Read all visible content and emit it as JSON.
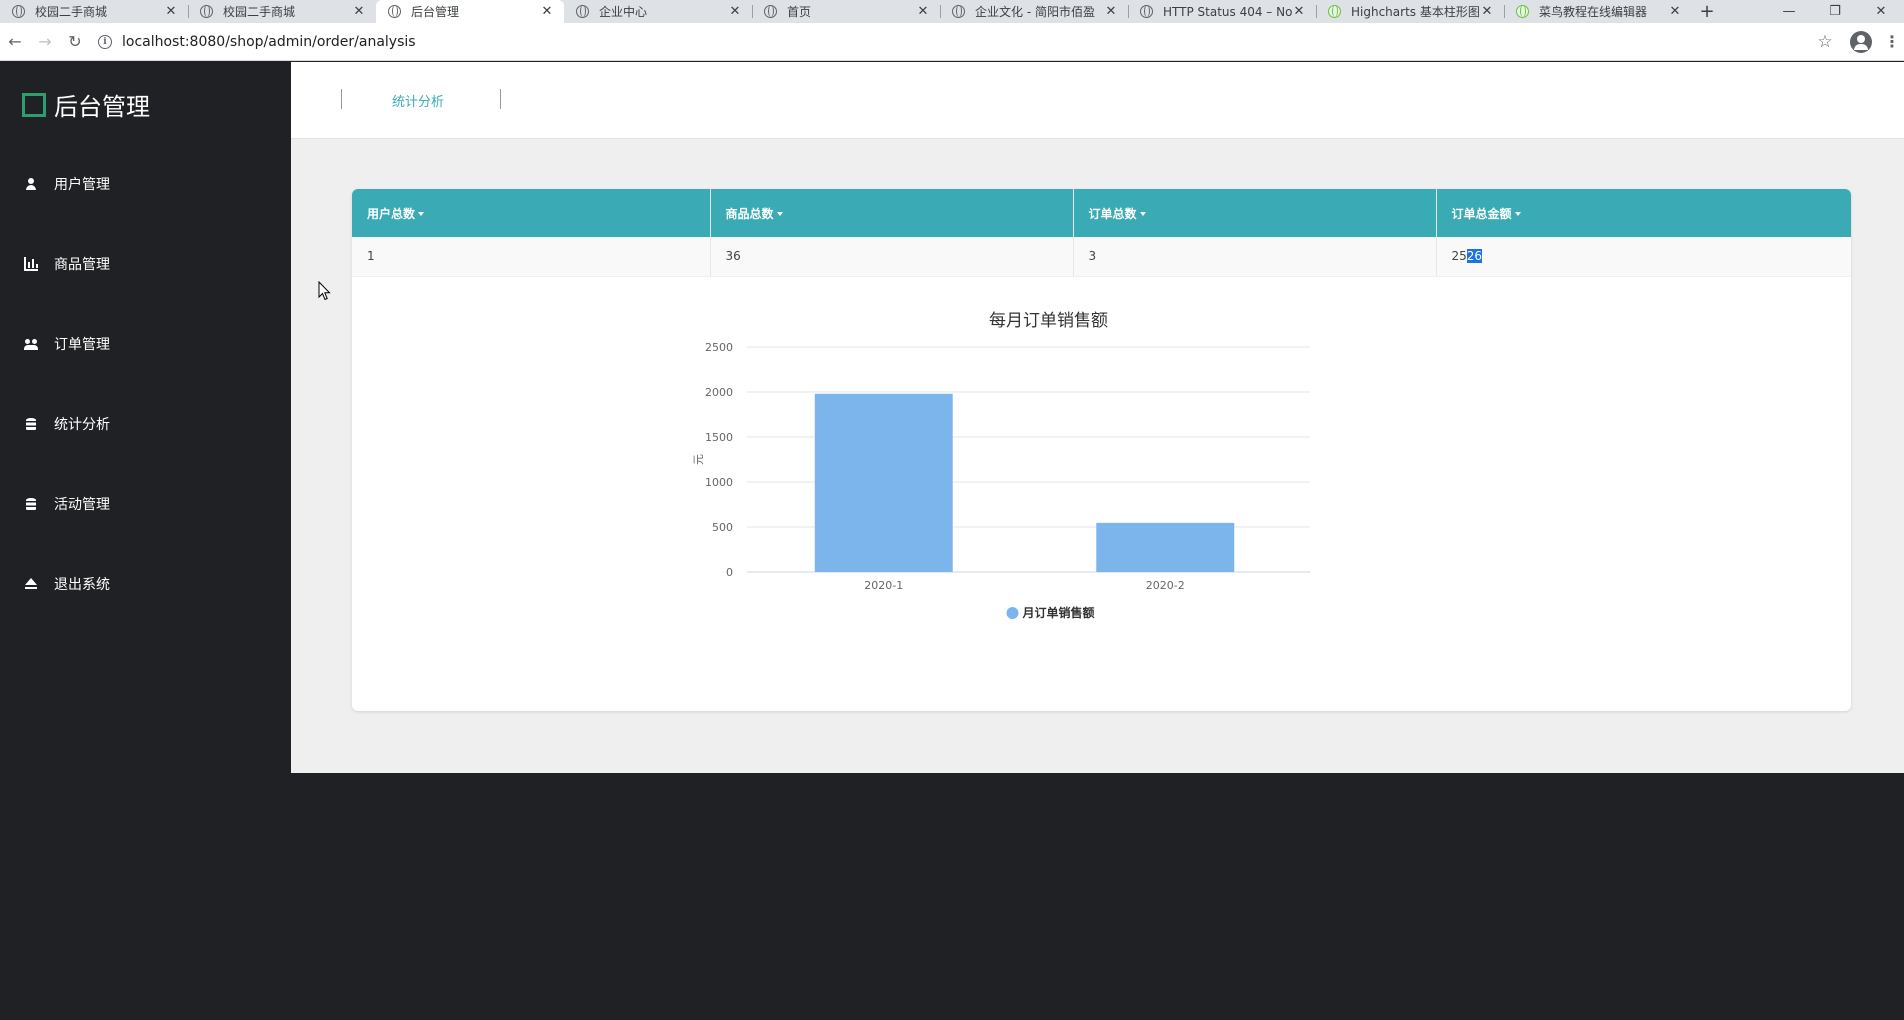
{
  "browser": {
    "tabs": [
      {
        "title": "校园二手商城",
        "favicon": "globe-icon",
        "active": false
      },
      {
        "title": "校园二手商城",
        "favicon": "globe-icon",
        "active": false
      },
      {
        "title": "后台管理",
        "favicon": "globe-icon",
        "active": true
      },
      {
        "title": "企业中心",
        "favicon": "globe-icon",
        "active": false
      },
      {
        "title": "首页",
        "favicon": "globe-icon",
        "active": false
      },
      {
        "title": "企业文化 - 简阳市佰盈",
        "favicon": "globe-icon",
        "active": false
      },
      {
        "title": "HTTP Status 404 – No",
        "favicon": "globe-icon",
        "active": false
      },
      {
        "title": "Highcharts 基本柱形图",
        "favicon": "runoob-icon",
        "active": false
      },
      {
        "title": "菜鸟教程在线编辑器",
        "favicon": "runoob-icon",
        "active": false
      }
    ],
    "new_tab": "+",
    "url": "localhost:8080/shop/admin/order/analysis"
  },
  "sidebar": {
    "brand": "后台管理",
    "items": [
      {
        "label": "用户管理",
        "icon": "user-icon"
      },
      {
        "label": "商品管理",
        "icon": "bar-chart-icon"
      },
      {
        "label": "订单管理",
        "icon": "users-icon"
      },
      {
        "label": "统计分析",
        "icon": "database-icon"
      },
      {
        "label": "活动管理",
        "icon": "database-icon"
      },
      {
        "label": "退出系统",
        "icon": "eject-icon"
      }
    ]
  },
  "header": {
    "breadcrumb": "统计分析"
  },
  "stats": {
    "headers": [
      "用户总数",
      "商品总数",
      "订单总数",
      "订单总金额"
    ],
    "values": [
      "1",
      "36",
      "3",
      "2526"
    ]
  },
  "chart_data": {
    "type": "bar",
    "title": "每月订单销售额",
    "xlabel": "",
    "ylabel": "元",
    "categories": [
      "2020-1",
      "2020-2"
    ],
    "series": [
      {
        "name": "月订单销售额",
        "values": [
          1980,
          546
        ]
      }
    ],
    "ylim": [
      0,
      2500
    ],
    "yticks": [
      0,
      500,
      1000,
      1500,
      2000,
      2500
    ],
    "grid": true,
    "legend": "bottom-center"
  },
  "colors": {
    "accent": "#3aabb5",
    "bar": "#7cb5ec",
    "sidebar": "#202124",
    "brand": "#2f9e6e"
  }
}
